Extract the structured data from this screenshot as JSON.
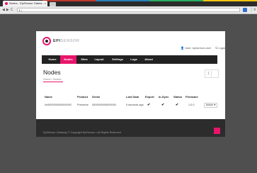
{
  "browser": {
    "tab_title": "Nodes - EpiSensor Gatew...",
    "tab_close": "×",
    "url": "ℹ | ",
    "nav_icons": [
      "◀",
      "▶",
      "C",
      "⌂"
    ],
    "ext_icons": [
      "⋮",
      "≡"
    ]
  },
  "app": {
    "brand_bold": "EPI",
    "brand_light": "SENSOR",
    "user_links": [
      "👤 User: episensor-user",
      "⏻ Logout"
    ],
    "menu": [
      {
        "label": "Home",
        "active": false
      },
      {
        "label": "Nodes",
        "active": true
      },
      {
        "label": "Sites",
        "active": false
      },
      {
        "label": "Layout",
        "active": false
      },
      {
        "label": "Settings",
        "active": false
      },
      {
        "label": "Logs",
        "active": false
      },
      {
        "label": "About",
        "active": false
      }
    ],
    "accent_color": "#e8156b"
  },
  "page": {
    "title": "Nodes",
    "breadcrumb": "Home / Nodes",
    "pager": {
      "current": "1"
    }
  },
  "table": {
    "columns": [
      "Name",
      "Product",
      "Serial",
      "Last Data",
      "Export",
      "In-Sync",
      "Status",
      "Firmware"
    ],
    "rows": [
      {
        "name": "0x0000000000000000",
        "product": "Presence",
        "serial": "0000000000000000",
        "last_data": "5 seconds ago",
        "export": "✔",
        "in_sync": "✔",
        "status": "✔",
        "firmware": "1.0.0",
        "action": "Action ▾"
      }
    ]
  },
  "footer": {
    "text": "EpiSensor Gateway © Copyright EpiSensor • All Rights Reserved"
  }
}
